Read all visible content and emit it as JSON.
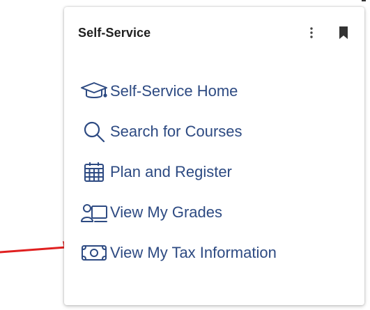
{
  "colors": {
    "link": "#2d4a82",
    "title": "#1f1f1f",
    "arrow": "#e02020"
  },
  "card": {
    "title": "Self-Service",
    "more_icon": "more-vertical-icon",
    "bookmark_icon": "bookmark-icon"
  },
  "menu": {
    "items": [
      {
        "label": "Self-Service Home",
        "icon": "graduation-cap-icon"
      },
      {
        "label": "Search for Courses",
        "icon": "search-icon"
      },
      {
        "label": "Plan and Register",
        "icon": "calendar-icon"
      },
      {
        "label": "View My Grades",
        "icon": "grades-icon"
      },
      {
        "label": "View My Tax Information",
        "icon": "money-icon"
      }
    ]
  },
  "annotation": {
    "icon": "red-arrow-icon"
  }
}
